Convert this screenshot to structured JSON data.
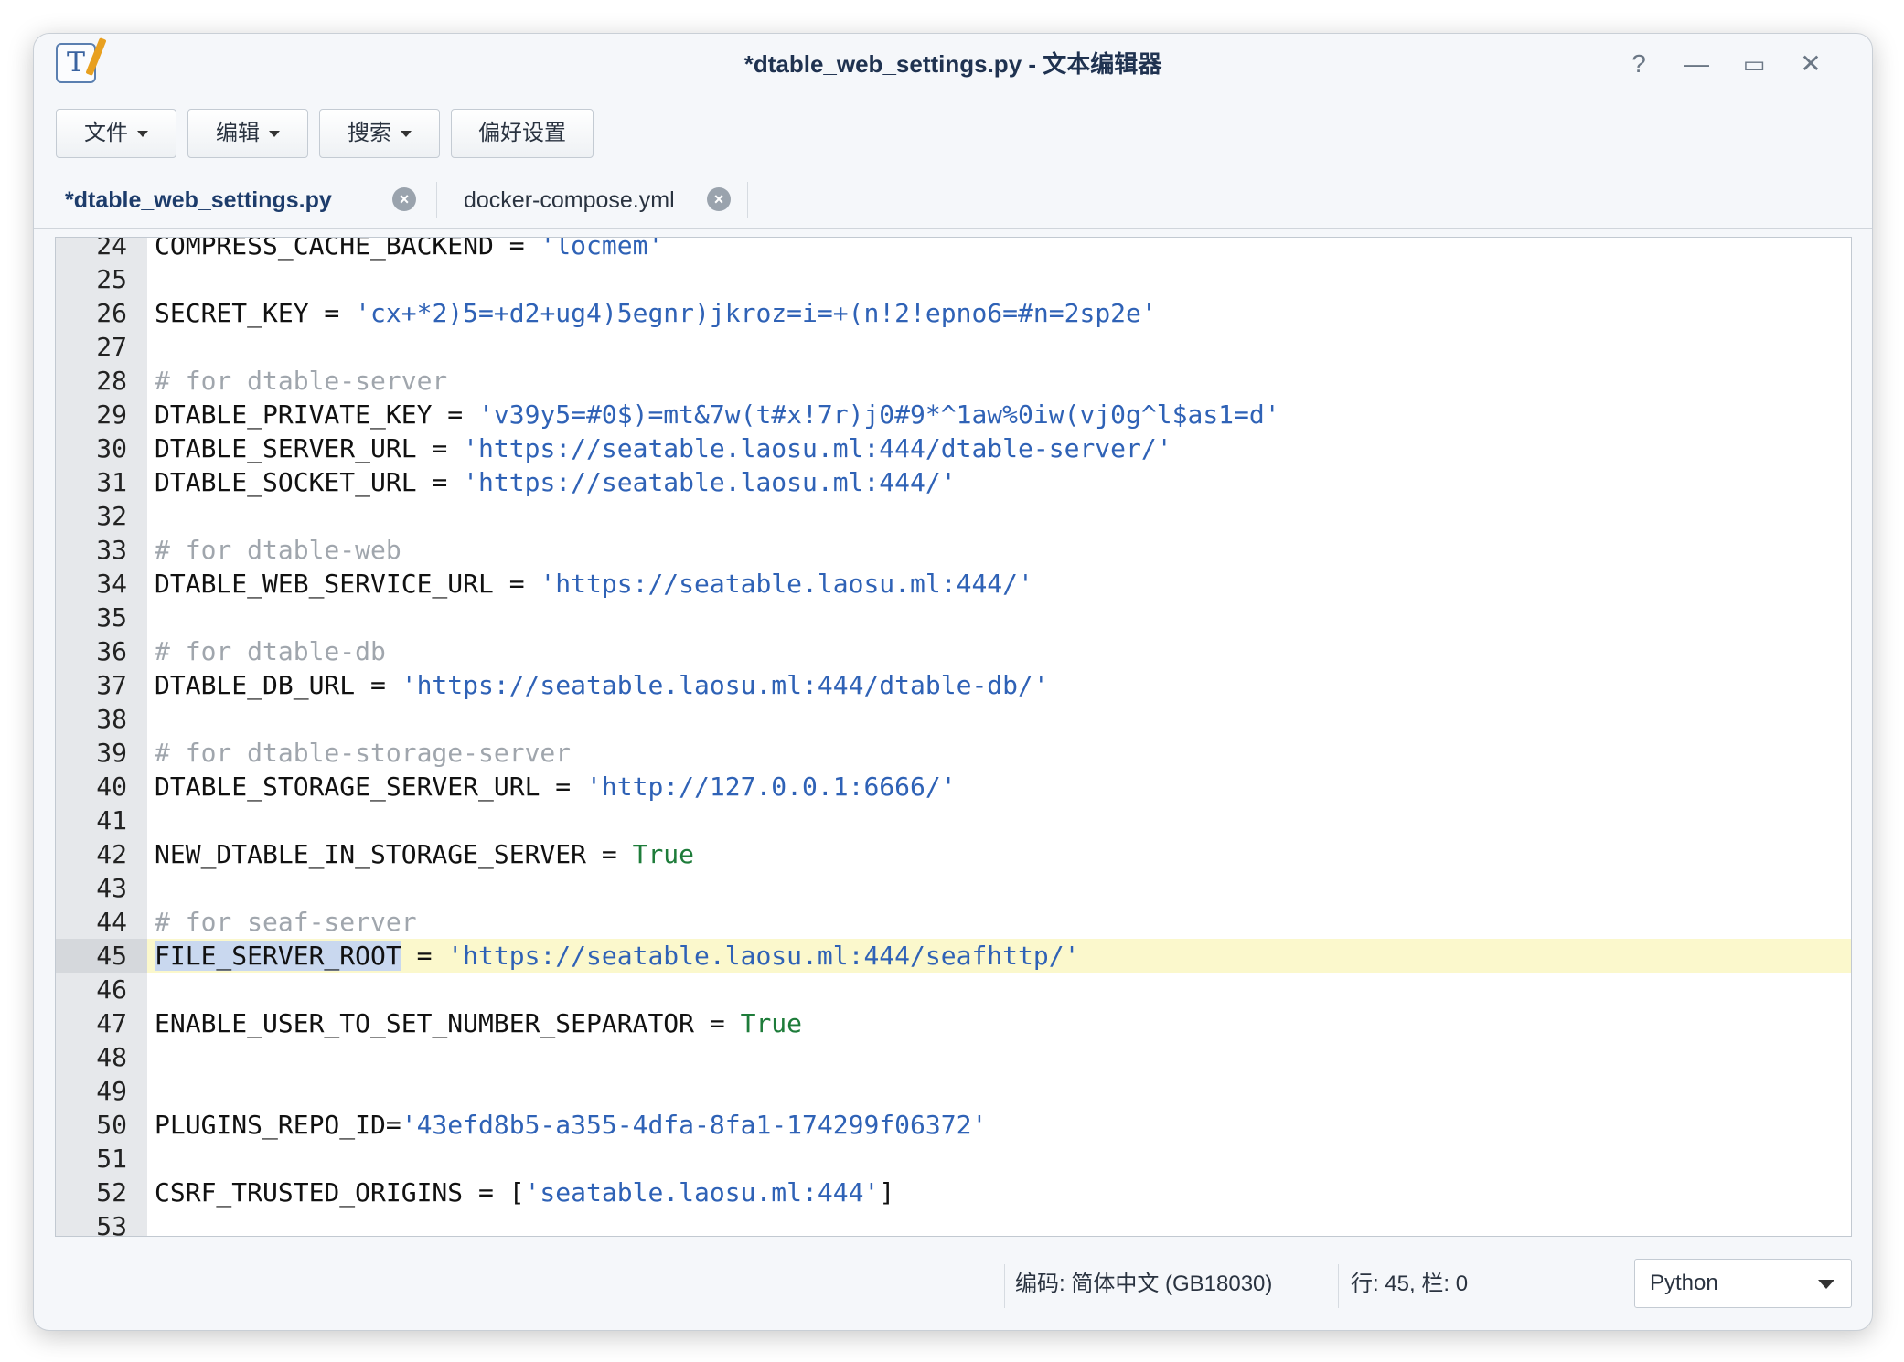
{
  "window": {
    "title": "*dtable_web_settings.py - 文本编辑器",
    "controls": {
      "help": "?",
      "minimize": "—",
      "maximize": "▭",
      "close": "✕"
    }
  },
  "toolbar": {
    "file": "文件",
    "edit": "编辑",
    "search": "搜索",
    "preferences": "偏好设置"
  },
  "tabs": [
    {
      "label": "*dtable_web_settings.py",
      "active": true
    },
    {
      "label": "docker-compose.yml",
      "active": false
    }
  ],
  "editor": {
    "current_line": 45,
    "lines": [
      {
        "n": 24,
        "tokens": [
          {
            "t": "COMPRESS_CACHE_BACKEND = "
          },
          {
            "t": "'locmem'",
            "c": "str"
          }
        ]
      },
      {
        "n": 25,
        "tokens": []
      },
      {
        "n": 26,
        "tokens": [
          {
            "t": "SECRET_KEY = "
          },
          {
            "t": "'cx+*2)5=+d2+ug4)5egnr)jkroz=i=+(n!2!epno6=#n=2sp2e'",
            "c": "str"
          }
        ]
      },
      {
        "n": 27,
        "tokens": []
      },
      {
        "n": 28,
        "tokens": [
          {
            "t": "# for dtable-server",
            "c": "cmt"
          }
        ]
      },
      {
        "n": 29,
        "tokens": [
          {
            "t": "DTABLE_PRIVATE_KEY = "
          },
          {
            "t": "'v39y5=#0$)=mt&7w(t#x!7r)j0#9*^1aw%0iw(vj0g^l$as1=d'",
            "c": "str"
          }
        ]
      },
      {
        "n": 30,
        "tokens": [
          {
            "t": "DTABLE_SERVER_URL = "
          },
          {
            "t": "'https://seatable.laosu.ml:444/dtable-server/'",
            "c": "str"
          }
        ]
      },
      {
        "n": 31,
        "tokens": [
          {
            "t": "DTABLE_SOCKET_URL = "
          },
          {
            "t": "'https://seatable.laosu.ml:444/'",
            "c": "str"
          }
        ]
      },
      {
        "n": 32,
        "tokens": []
      },
      {
        "n": 33,
        "tokens": [
          {
            "t": "# for dtable-web",
            "c": "cmt"
          }
        ]
      },
      {
        "n": 34,
        "tokens": [
          {
            "t": "DTABLE_WEB_SERVICE_URL = "
          },
          {
            "t": "'https://seatable.laosu.ml:444/'",
            "c": "str"
          }
        ]
      },
      {
        "n": 35,
        "tokens": []
      },
      {
        "n": 36,
        "tokens": [
          {
            "t": "# for dtable-db",
            "c": "cmt"
          }
        ]
      },
      {
        "n": 37,
        "tokens": [
          {
            "t": "DTABLE_DB_URL = "
          },
          {
            "t": "'https://seatable.laosu.ml:444/dtable-db/'",
            "c": "str"
          }
        ]
      },
      {
        "n": 38,
        "tokens": []
      },
      {
        "n": 39,
        "tokens": [
          {
            "t": "# for dtable-storage-server",
            "c": "cmt"
          }
        ]
      },
      {
        "n": 40,
        "tokens": [
          {
            "t": "DTABLE_STORAGE_SERVER_URL = "
          },
          {
            "t": "'http://127.0.0.1:6666/'",
            "c": "str"
          }
        ]
      },
      {
        "n": 41,
        "tokens": []
      },
      {
        "n": 42,
        "tokens": [
          {
            "t": "NEW_DTABLE_IN_STORAGE_SERVER = "
          },
          {
            "t": "True",
            "c": "kw"
          }
        ]
      },
      {
        "n": 43,
        "tokens": []
      },
      {
        "n": 44,
        "tokens": [
          {
            "t": "# for seaf-server",
            "c": "cmt"
          }
        ]
      },
      {
        "n": 45,
        "tokens": [
          {
            "t": "FILE_SERVER_ROOT",
            "c": "sel"
          },
          {
            "t": " = "
          },
          {
            "t": "'https://seatable.laosu.ml:444/seafhttp/'",
            "c": "str"
          }
        ]
      },
      {
        "n": 46,
        "tokens": []
      },
      {
        "n": 47,
        "tokens": [
          {
            "t": "ENABLE_USER_TO_SET_NUMBER_SEPARATOR = "
          },
          {
            "t": "True",
            "c": "kw"
          }
        ]
      },
      {
        "n": 48,
        "tokens": []
      },
      {
        "n": 49,
        "tokens": []
      },
      {
        "n": 50,
        "tokens": [
          {
            "t": "PLUGINS_REPO_ID="
          },
          {
            "t": "'43efd8b5-a355-4dfa-8fa1-174299f06372'",
            "c": "str"
          }
        ]
      },
      {
        "n": 51,
        "tokens": []
      },
      {
        "n": 52,
        "tokens": [
          {
            "t": "CSRF_TRUSTED_ORIGINS = ["
          },
          {
            "t": "'seatable.laosu.ml:444'",
            "c": "str"
          },
          {
            "t": "]"
          }
        ]
      },
      {
        "n": 53,
        "tokens": []
      }
    ]
  },
  "statusbar": {
    "encoding": "编码: 简体中文 (GB18030)",
    "position": "行: 45, 栏: 0",
    "language": "Python"
  },
  "colors": {
    "string": "#2f62b6",
    "comment": "#a0a6ad",
    "keyword": "#1e7c3a",
    "current_line": "#fbf8cc",
    "selection": "#c9d8ef"
  }
}
